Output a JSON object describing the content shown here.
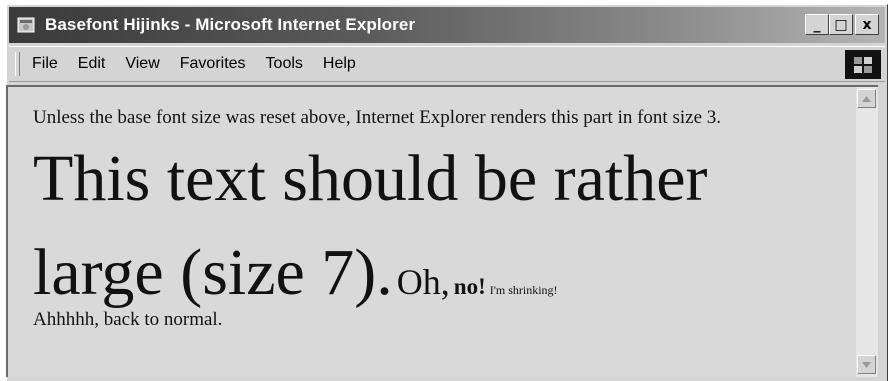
{
  "window": {
    "title": "Basefont Hijinks - Microsoft Internet Explorer",
    "controls": {
      "minimize": "_",
      "maximize": "□",
      "close": "x"
    }
  },
  "menubar": {
    "items": [
      "File",
      "Edit",
      "View",
      "Favorites",
      "Tools",
      "Help"
    ]
  },
  "page": {
    "line1": "Unless the base font size was reset above, Internet Explorer renders this part in font size 3.",
    "big_line1": "This text should be rather",
    "big_line2": "large (size 7).",
    "oh": "Oh,",
    "no": "no!",
    "shrinking": "I'm shrinking!",
    "normal": "Ahhhhh, back to normal."
  },
  "colors": {
    "titlebar_start": "#3a3a3a",
    "titlebar_end": "#b4b4b4",
    "chrome": "#d4d4d4",
    "content_bg": "#d9d9d9"
  }
}
